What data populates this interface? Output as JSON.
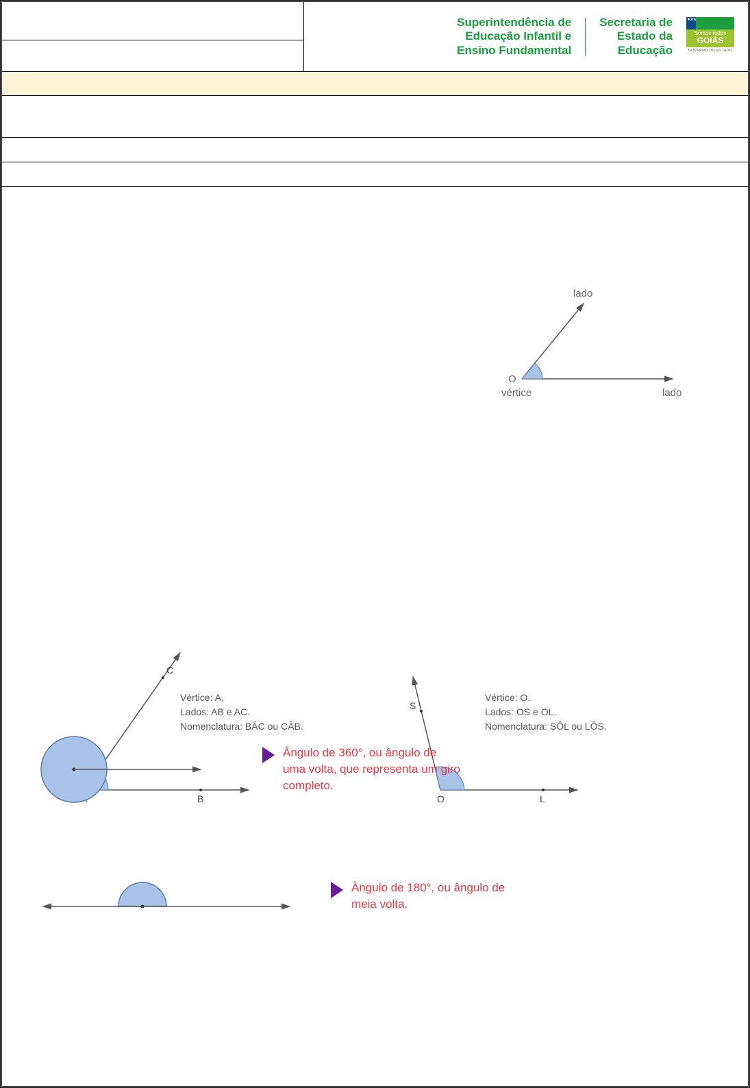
{
  "header": {
    "logo1_line1": "Superintendência de",
    "logo1_line2": "Educação Infantil e",
    "logo1_line3": "Ensino Fundamental",
    "logo2_line1": "Secretaria de",
    "logo2_line2": "Estado da",
    "logo2_line3": "Educação",
    "goias_top": "Somos todos",
    "goias_main": "GOIÁS",
    "goias_sub": "GOVERNO DO ESTADO"
  },
  "figure1": {
    "lado_top": "lado",
    "lado_right": "lado",
    "vertex_o": "O",
    "vertice": "vértice"
  },
  "example_a": {
    "c": "C",
    "a": "A",
    "b": "B",
    "line1": "Vértice: A.",
    "line2": "Lados: AB e AC.",
    "line3": "Nomenclatura: BÂC ou CÂB."
  },
  "example_o": {
    "s": "S",
    "o": "O",
    "l": "L",
    "line1": "Vértice: O.",
    "line2": "Lados: OS e OL.",
    "line3": "Nomenclatura: SÔL ou LÔS."
  },
  "caption360": "Ângulo de 360°, ou ângulo de uma volta, que representa um giro completo.",
  "caption180": "Ângulo de 180°, ou ângulo de meia volta."
}
